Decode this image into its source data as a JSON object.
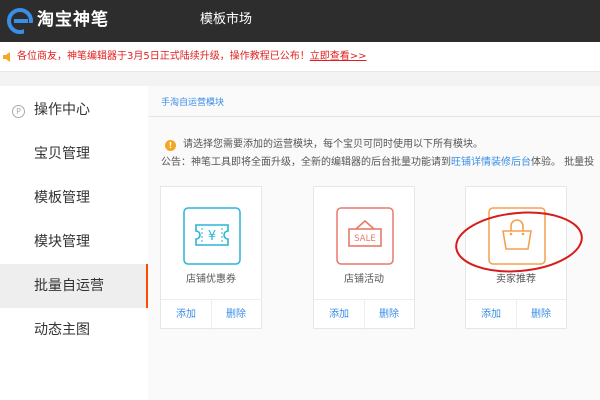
{
  "header": {
    "brand": "淘宝神笔",
    "tab": "模板市场"
  },
  "notice": {
    "text": "各位商友，神笔编辑器于3月5日正式陆续升级，操作教程已公布！",
    "link": "立即查看>>"
  },
  "sidebar": {
    "items": [
      {
        "label": "操作中心",
        "icon": "operation-icon",
        "icon_glyph": "P"
      },
      {
        "label": "宝贝管理"
      },
      {
        "label": "模板管理"
      },
      {
        "label": "模块管理"
      },
      {
        "label": "批量自运营",
        "active": true
      },
      {
        "label": "动态主图"
      }
    ]
  },
  "main": {
    "breadcrumb": "手淘自运营模块",
    "info": {
      "icon_glyph": "!",
      "line1": "请选择您需要添加的运营模块，每个宝贝可同时使用以下所有模块。",
      "line2_prefix": "公告：神笔工具即将全面升级，全新的编辑器的后台批量功能请到",
      "line2_link": "旺铺详情装修后台",
      "line2_suffix": "体验。 批量投"
    },
    "cards": [
      {
        "name": "店铺优惠券",
        "icon": "coupon-icon",
        "icon_text": "¥",
        "color": "#2ab5d6",
        "add": "添加",
        "del": "删除"
      },
      {
        "name": "店铺活动",
        "icon": "sale-tag-icon",
        "icon_text": "SALE",
        "color": "#e8796b",
        "add": "添加",
        "del": "删除"
      },
      {
        "name": "卖家推荐",
        "icon": "shopping-bag-icon",
        "color": "#f5a14d",
        "add": "添加",
        "del": "删除"
      }
    ]
  },
  "colors": {
    "topbar": "#2d2d2d",
    "accent": "#ff4a00",
    "link": "#3a8ee6",
    "notice": "#e02020",
    "annotation": "#d81b1b"
  }
}
